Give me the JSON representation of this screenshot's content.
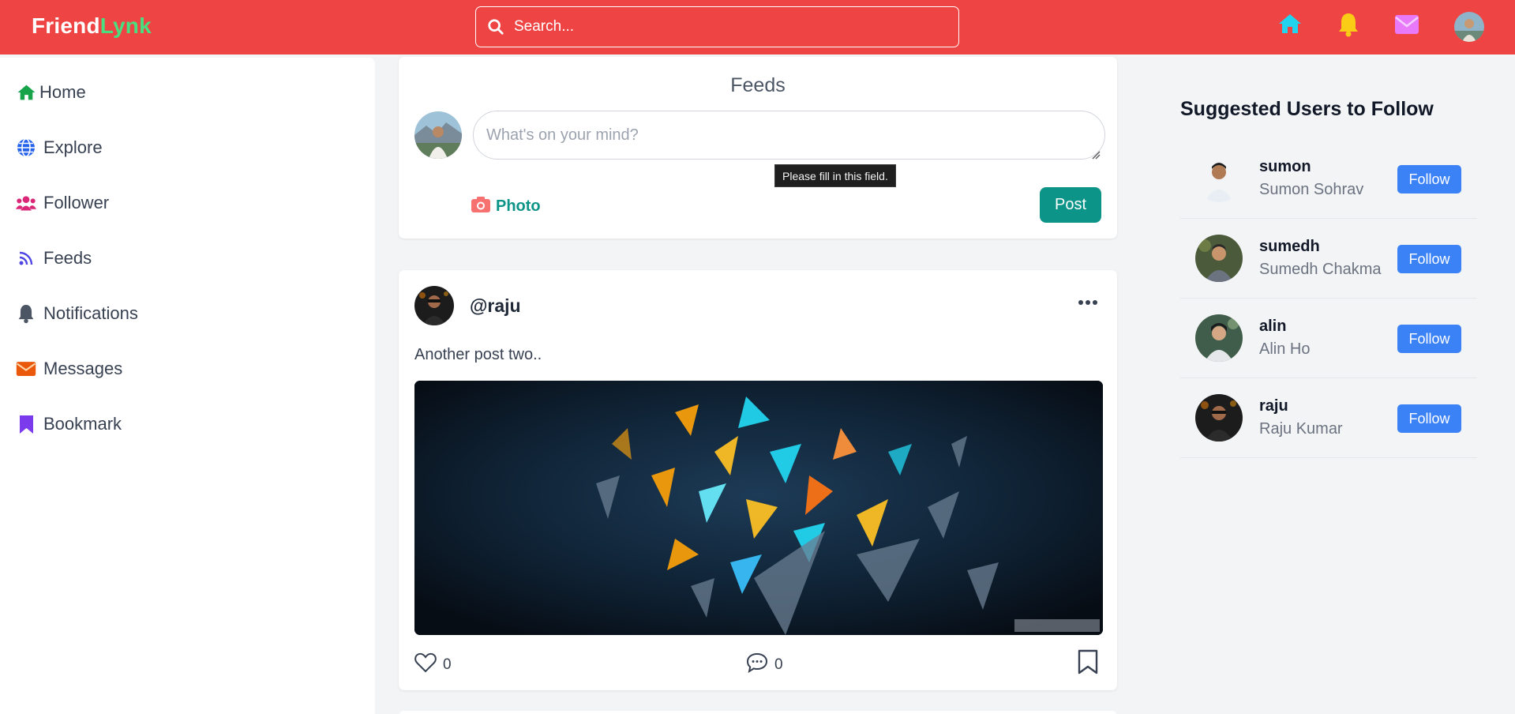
{
  "brand": {
    "part1": "Friend",
    "part2": "Lynk"
  },
  "search": {
    "placeholder": "Search..."
  },
  "header_icons": [
    "home-icon",
    "bell-icon",
    "envelope-icon",
    "avatar"
  ],
  "colors": {
    "header": "#ef4444",
    "brand_accent": "#4ade80",
    "teal": "#0d9488",
    "follow": "#3b82f6"
  },
  "sidebar": {
    "items": [
      {
        "label": "Home",
        "icon": "home-icon"
      },
      {
        "label": "Explore",
        "icon": "globe-icon"
      },
      {
        "label": "Follower",
        "icon": "users-icon"
      },
      {
        "label": "Feeds",
        "icon": "rss-icon"
      },
      {
        "label": "Notifications",
        "icon": "bell-icon"
      },
      {
        "label": "Messages",
        "icon": "envelope-icon"
      },
      {
        "label": "Bookmark",
        "icon": "bookmark-icon"
      }
    ]
  },
  "composer": {
    "title": "Feeds",
    "placeholder": "What's on your mind?",
    "tooltip": "Please fill in this field.",
    "photo_label": "Photo",
    "post_label": "Post"
  },
  "post": {
    "username": "@raju",
    "text": "Another post two..",
    "likes": "0",
    "comments": "0"
  },
  "suggested": {
    "title": "Suggested Users to Follow",
    "follow_label": "Follow",
    "users": [
      {
        "username": "sumon",
        "name": "Sumon Sohrav"
      },
      {
        "username": "sumedh",
        "name": "Sumedh Chakma"
      },
      {
        "username": "alin",
        "name": "Alin Ho"
      },
      {
        "username": "raju",
        "name": "Raju Kumar"
      }
    ]
  }
}
